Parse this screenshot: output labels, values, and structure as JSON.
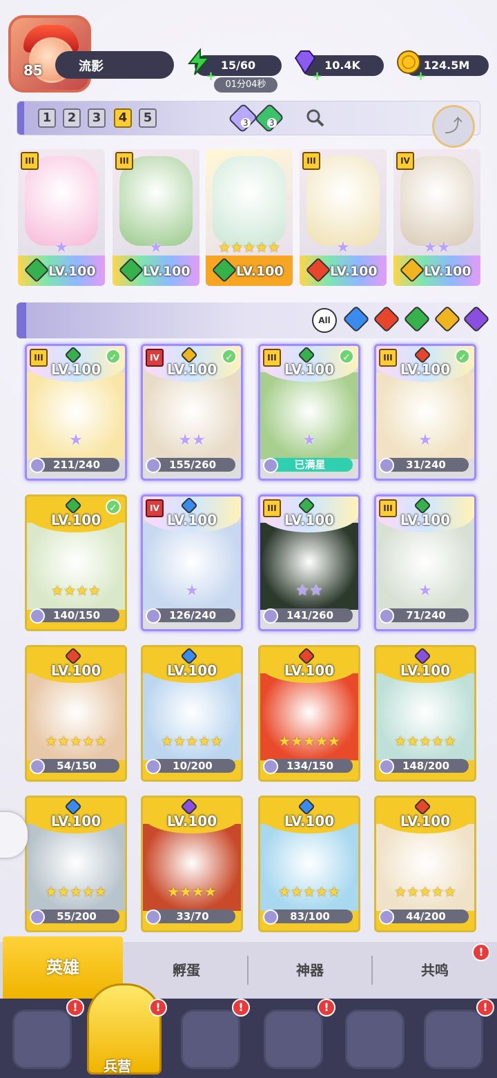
{
  "player": {
    "level": "85",
    "name": "流影"
  },
  "resources": {
    "energy": "15/60",
    "gems": "10.4K",
    "gold": "124.5M",
    "timer": "01分04秒"
  },
  "teams": {
    "numbers": [
      "1",
      "2",
      "3",
      "4",
      "5"
    ],
    "active_index": 4,
    "gem_purple_count": "3",
    "gem_green_count": "3"
  },
  "team_heroes": [
    {
      "rank": "III",
      "level": "LV.100",
      "stars": "★",
      "element": "nature",
      "color": "#f7b8d8"
    },
    {
      "rank": "III",
      "level": "LV.100",
      "stars": "★",
      "element": "nature",
      "color": "#9ac98a"
    },
    {
      "rank": "",
      "level": "LV.100",
      "stars": "★★★★★",
      "element": "nature",
      "color": "#c9e6d4",
      "selected": true
    },
    {
      "rank": "III",
      "level": "LV.100",
      "stars": "★",
      "element": "fire",
      "color": "#efe0b0"
    },
    {
      "rank": "IV",
      "level": "LV.100",
      "stars": "★★",
      "element": "light",
      "color": "#d8c9b2"
    }
  ],
  "filter": {
    "all_label": "All",
    "elements": [
      "water",
      "fire",
      "nature",
      "light",
      "dark"
    ]
  },
  "element_colors": {
    "water": "#3a8bf0",
    "fire": "#e8452c",
    "nature": "#36b24c",
    "light": "#f0b420",
    "dark": "#8a4fe0"
  },
  "heroes": [
    {
      "rank": "III",
      "level": "LV.100",
      "stars": "★",
      "progress": "211/240",
      "element": "nature",
      "check": true,
      "style": "purple",
      "color": "#f9e6a6"
    },
    {
      "rank": "IV",
      "level": "LV.100",
      "stars": "★★",
      "progress": "155/260",
      "element": "light",
      "check": true,
      "style": "purple",
      "color": "#e8dcc8"
    },
    {
      "rank": "III",
      "level": "LV.100",
      "stars": "★",
      "progress": "已满星",
      "element": "nature",
      "check": true,
      "style": "purple",
      "color": "#a8cf8e",
      "full": true
    },
    {
      "rank": "III",
      "level": "LV.100",
      "stars": "★",
      "progress": "31/240",
      "element": "fire",
      "check": true,
      "style": "purple",
      "color": "#f0e2c2"
    },
    {
      "rank": "",
      "level": "LV.100",
      "stars": "★★★★",
      "progress": "140/150",
      "element": "nature",
      "check": true,
      "style": "gold",
      "color": "#d9e8c8"
    },
    {
      "rank": "IV",
      "level": "LV.100",
      "stars": "★",
      "progress": "126/240",
      "element": "water",
      "check": false,
      "style": "purple",
      "color": "#c8d8f0"
    },
    {
      "rank": "III",
      "level": "LV.100",
      "stars": "★★",
      "progress": "141/260",
      "element": "nature",
      "check": false,
      "style": "purple",
      "color": "#2c3a2c"
    },
    {
      "rank": "III",
      "level": "LV.100",
      "stars": "★",
      "progress": "71/240",
      "element": "nature",
      "check": false,
      "style": "purple",
      "color": "#d8e0d4"
    },
    {
      "rank": "",
      "level": "LV.100",
      "stars": "★★★★★",
      "progress": "54/150",
      "element": "fire",
      "check": false,
      "style": "gold",
      "color": "#e8c8a8"
    },
    {
      "rank": "",
      "level": "LV.100",
      "stars": "★★★★★",
      "progress": "10/200",
      "element": "water",
      "check": false,
      "style": "gold",
      "color": "#bcd6f0"
    },
    {
      "rank": "",
      "level": "LV.100",
      "stars": "★★★★★",
      "progress": "134/150",
      "element": "fire",
      "check": false,
      "style": "gold",
      "color": "#e84a2a"
    },
    {
      "rank": "",
      "level": "LV.100",
      "stars": "★★★★★",
      "progress": "148/200",
      "element": "dark",
      "check": false,
      "style": "gold",
      "color": "#bfe0d8"
    },
    {
      "rank": "",
      "level": "LV.100",
      "stars": "★★★★★",
      "progress": "55/200",
      "element": "water",
      "check": false,
      "style": "gold",
      "color": "#b8c4cc"
    },
    {
      "rank": "",
      "level": "LV.100",
      "stars": "★★★★",
      "progress": "33/70",
      "element": "dark",
      "check": false,
      "style": "gold",
      "color": "#c84a2a"
    },
    {
      "rank": "",
      "level": "LV.100",
      "stars": "★★★★★",
      "progress": "83/100",
      "element": "water",
      "check": false,
      "style": "gold",
      "color": "#a8d8f0"
    },
    {
      "rank": "",
      "level": "LV.100",
      "stars": "★★★★★",
      "progress": "44/200",
      "element": "fire",
      "check": false,
      "style": "gold",
      "color": "#f0e2c8"
    }
  ],
  "tabs": {
    "hero": "英雄",
    "hatch": "孵蛋",
    "artifact": "神器",
    "resonance": "共鸣"
  },
  "nav": {
    "barracks": "兵营"
  }
}
